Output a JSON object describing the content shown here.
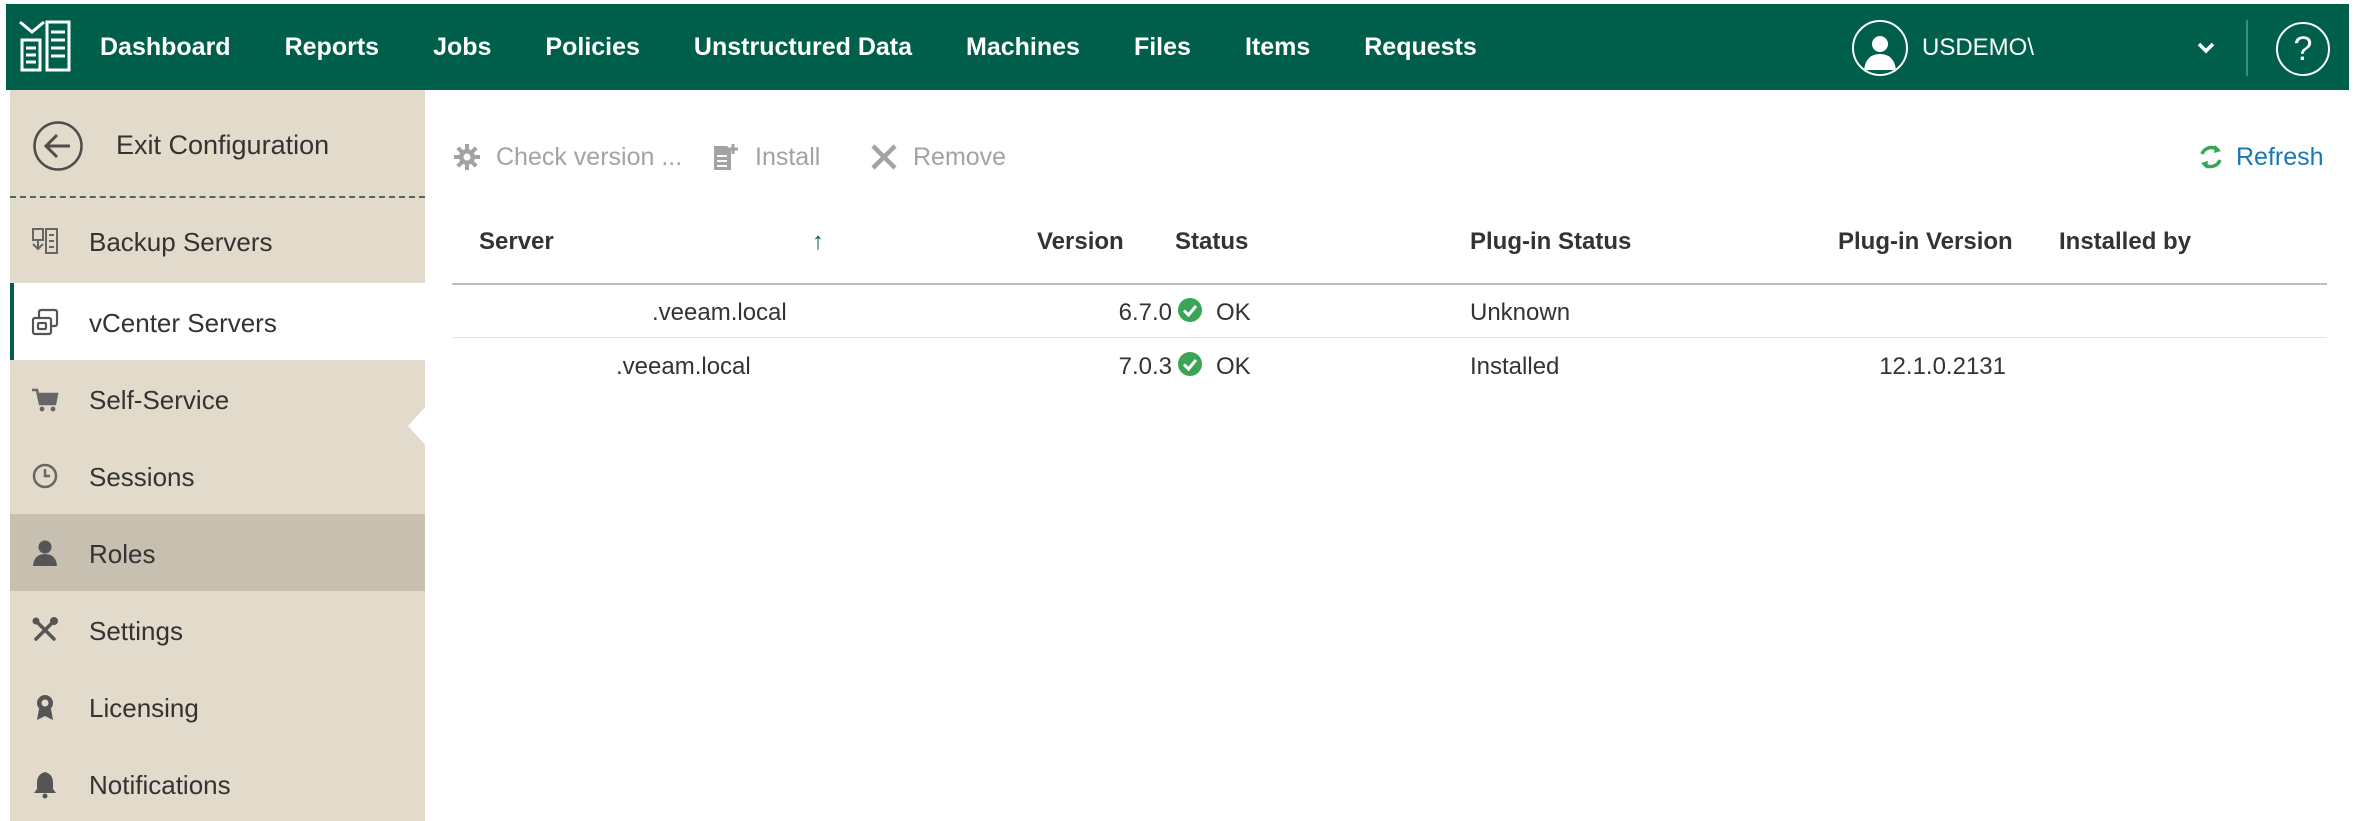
{
  "topbar": {
    "nav": [
      "Dashboard",
      "Reports",
      "Jobs",
      "Policies",
      "Unstructured Data",
      "Machines",
      "Files",
      "Items",
      "Requests"
    ],
    "user_name": "USDEMO\\",
    "help_label": "?"
  },
  "sidebar": {
    "exit_label": "Exit Configuration",
    "items": [
      {
        "label": "Backup Servers",
        "icon": "backup-servers-icon"
      },
      {
        "label": "vCenter Servers",
        "icon": "vcenter-servers-icon",
        "state": "active"
      },
      {
        "label": "Self-Service",
        "icon": "cart-icon"
      },
      {
        "label": "Sessions",
        "icon": "clock-icon"
      },
      {
        "label": "Roles",
        "icon": "user-icon",
        "state": "hover"
      },
      {
        "label": "Settings",
        "icon": "tools-icon"
      },
      {
        "label": "Licensing",
        "icon": "license-icon"
      },
      {
        "label": "Notifications",
        "icon": "bell-icon"
      }
    ]
  },
  "toolbar": {
    "check_version": "Check version ...",
    "install": "Install",
    "remove": "Remove",
    "refresh": "Refresh"
  },
  "table": {
    "columns": [
      "Server",
      "Version",
      "Status",
      "Plug-in Status",
      "Plug-in Version",
      "Installed by"
    ],
    "sort_indicator": "↑",
    "rows": [
      {
        "server": ".veeam.local",
        "version": "6.7.0",
        "status": "OK",
        "plugin_status": "Unknown",
        "plugin_version": "",
        "installed_by": ""
      },
      {
        "server": ".veeam.local",
        "version": "7.0.3",
        "status": "OK",
        "plugin_status": "Installed",
        "plugin_version": "12.1.0.2131",
        "installed_by": ""
      }
    ]
  },
  "colors": {
    "brand_green": "#005f4b",
    "sidebar_bg": "#e2dbcb",
    "link_blue": "#1877b8",
    "ok_green": "#3aa655"
  }
}
